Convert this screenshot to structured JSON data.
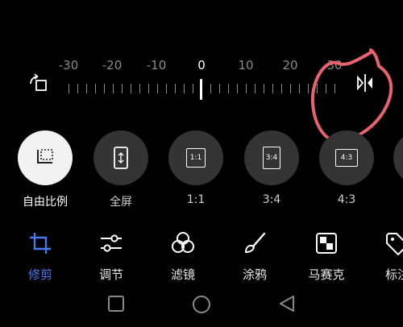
{
  "ruler": {
    "labels": [
      "-30",
      "-20",
      "-10",
      "0",
      "10",
      "20",
      "30"
    ],
    "current_value": "0"
  },
  "aspect_options": [
    {
      "label": "自由比例",
      "icon": "free-ratio-icon",
      "active": true
    },
    {
      "label": "全屏",
      "icon": "fullscreen-icon",
      "active": false
    },
    {
      "label": "1:1",
      "icon": "ratio-1-1-icon",
      "badge": "1:1",
      "active": false
    },
    {
      "label": "3:4",
      "icon": "ratio-3-4-icon",
      "badge": "3:4",
      "active": false
    },
    {
      "label": "4:3",
      "icon": "ratio-4-3-icon",
      "badge": "4:3",
      "active": false
    }
  ],
  "tools": [
    {
      "label": "修剪",
      "icon": "crop-icon",
      "active": true
    },
    {
      "label": "调节",
      "icon": "adjust-sliders-icon",
      "active": false
    },
    {
      "label": "滤镜",
      "icon": "filter-circles-icon",
      "active": false
    },
    {
      "label": "涂鸦",
      "icon": "brush-icon",
      "active": false
    },
    {
      "label": "马赛克",
      "icon": "mosaic-icon",
      "active": false
    },
    {
      "label": "标注",
      "icon": "tag-icon",
      "active": false
    }
  ],
  "colors": {
    "accent": "#4a78f0",
    "annotation": "#e8636e",
    "circle_bg": "#343434"
  }
}
